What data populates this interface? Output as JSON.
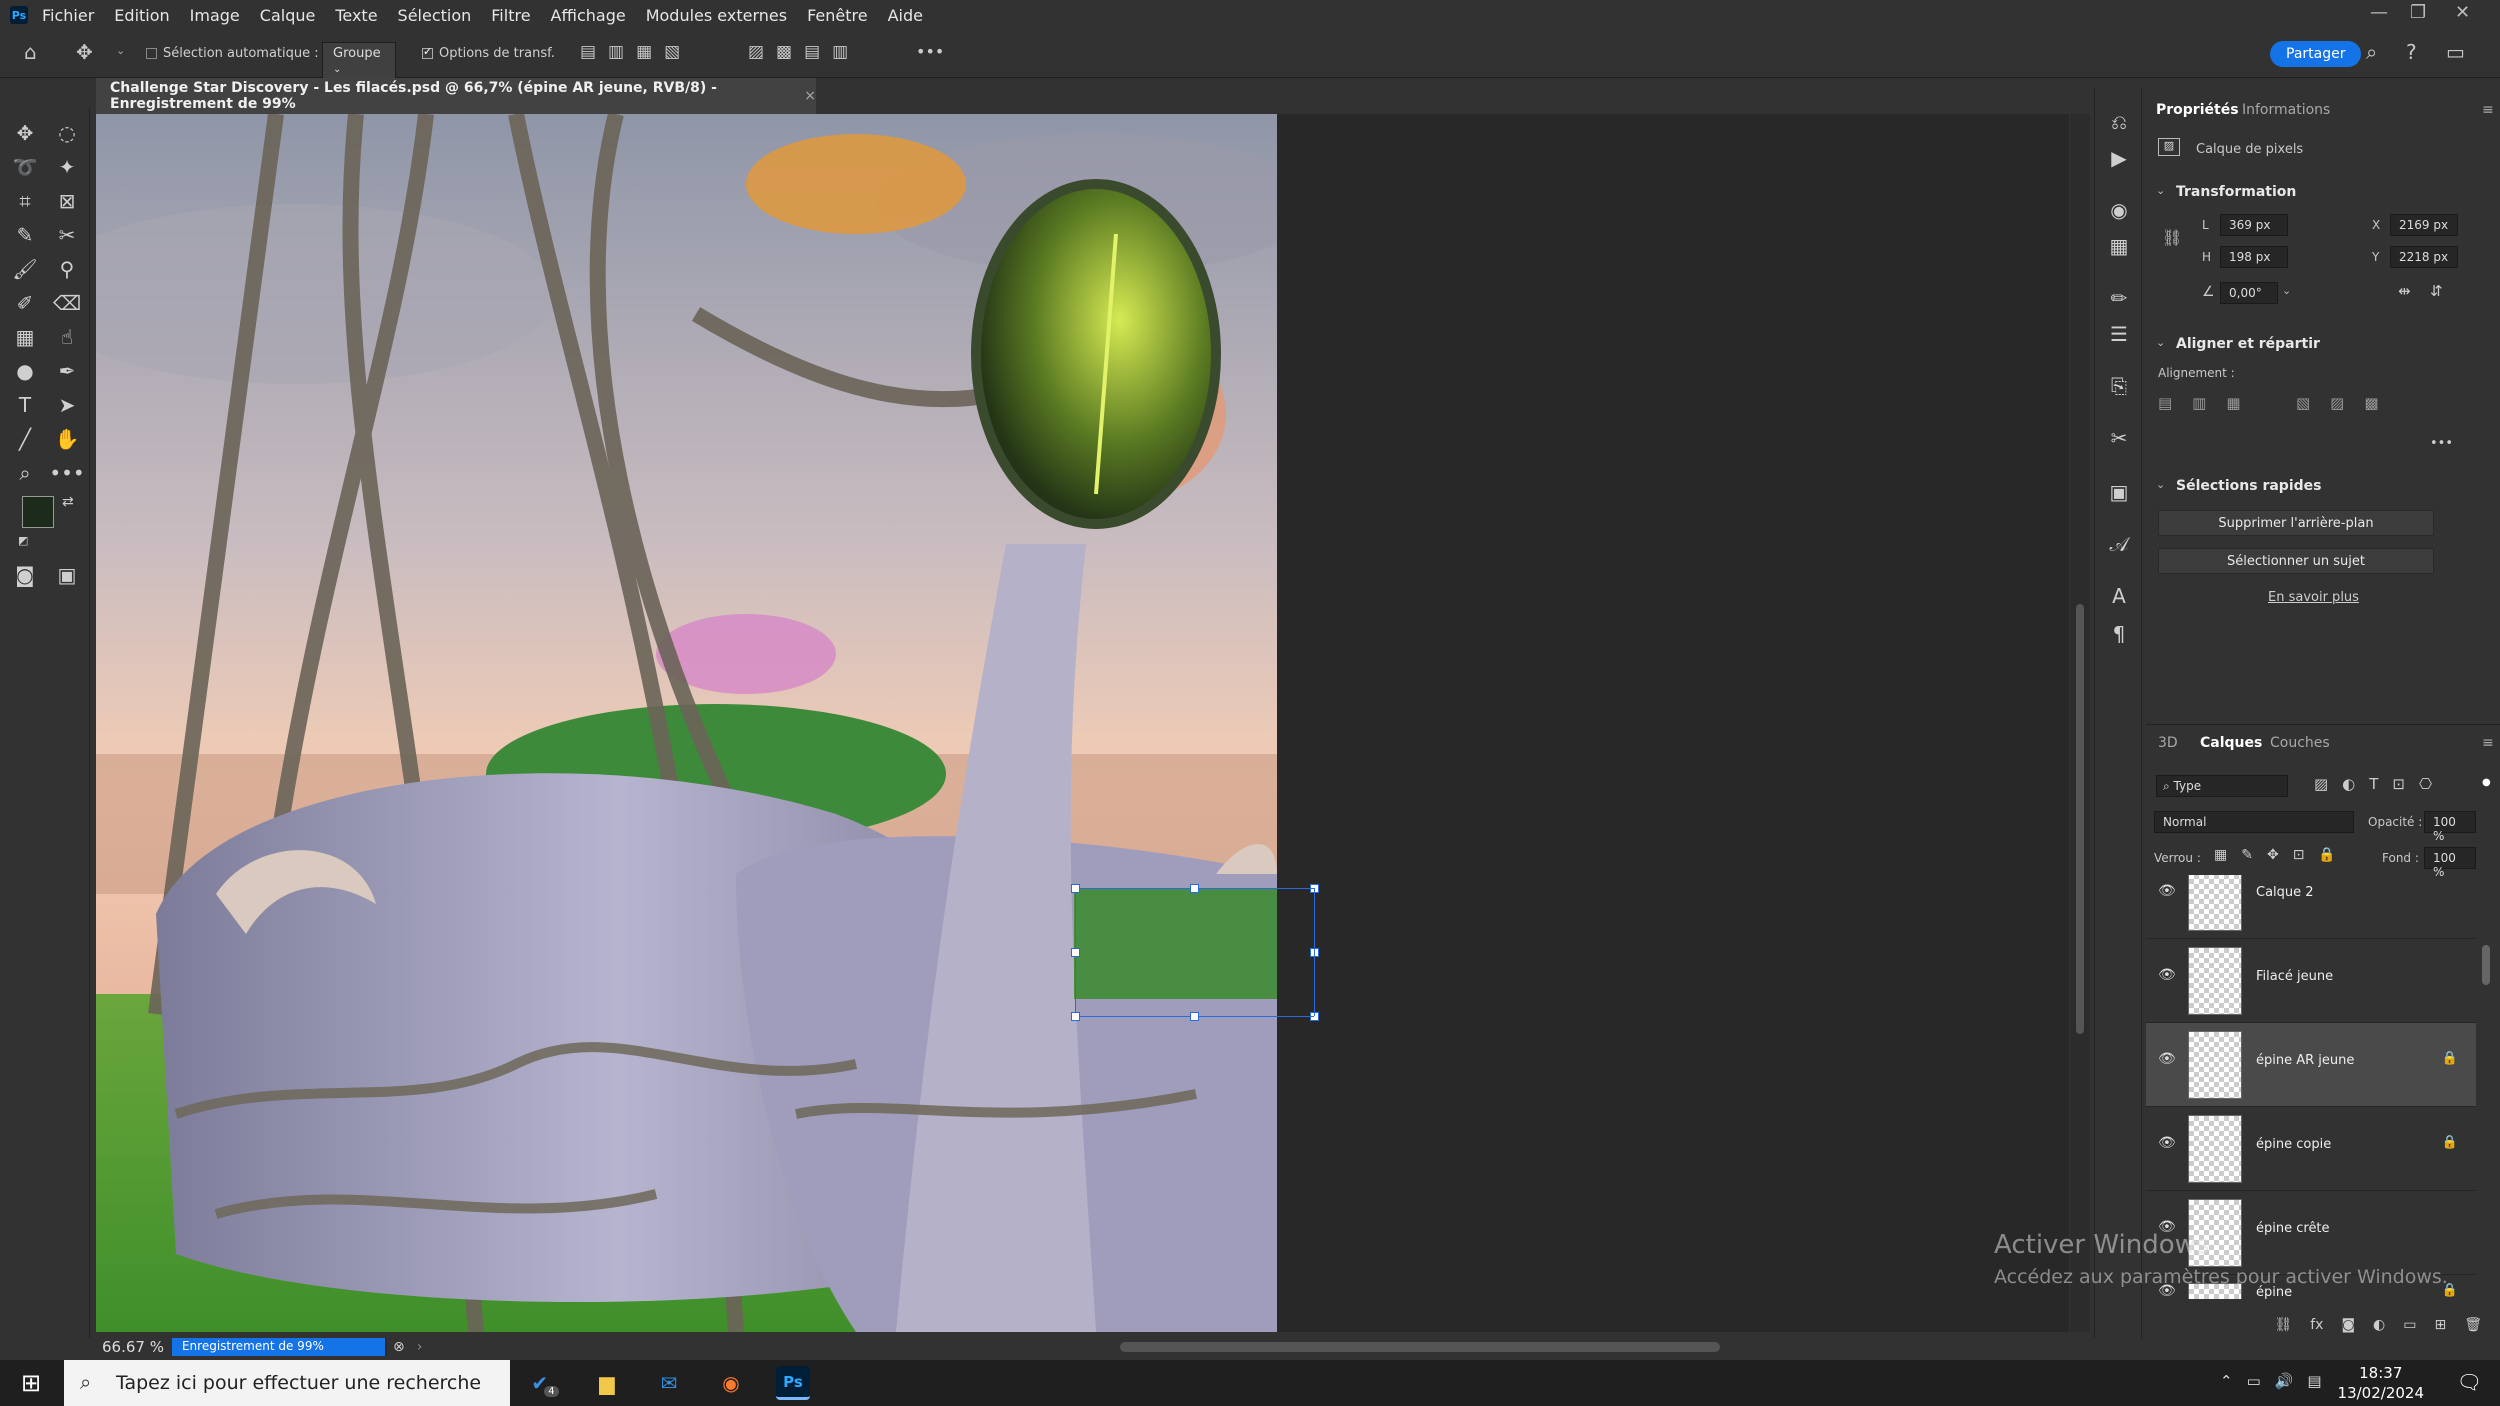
{
  "menubar": {
    "logo": "Ps",
    "items": [
      "Fichier",
      "Edition",
      "Image",
      "Calque",
      "Texte",
      "Sélection",
      "Filtre",
      "Affichage",
      "Modules externes",
      "Fenêtre",
      "Aide"
    ]
  },
  "options": {
    "auto_select_label": "Sélection automatique :",
    "group_value": "Groupe",
    "transform_options_label": "Options de transf.",
    "more": "•••",
    "share_label": "Partager"
  },
  "document": {
    "tab_title": "Challenge Star Discovery - Les filacés.psd @ 66,7% (épine AR jeune, RVB/8) - Enregistrement de 99%",
    "close_glyph": "×"
  },
  "properties": {
    "tabs": [
      "Propriétés",
      "Informations"
    ],
    "layer_type": "Calque de pixels",
    "transform_title": "Transformation",
    "w_label": "L",
    "w_value": "369 px",
    "h_label": "H",
    "h_value": "198 px",
    "x_label": "X",
    "x_value": "2169 px",
    "y_label": "Y",
    "y_value": "2218 px",
    "angle_value": "0,00°",
    "align_title": "Aligner et répartir",
    "alignment_label": "Alignement :",
    "quick_title": "Sélections rapides",
    "remove_bg": "Supprimer l'arrière-plan",
    "select_subject": "Sélectionner un sujet",
    "learn_more": "En savoir plus",
    "more": "•••"
  },
  "layers_panel": {
    "tabs": [
      "3D",
      "Calques",
      "Couches"
    ],
    "filter_value": "Type",
    "blend_mode": "Normal",
    "opacity_label": "Opacité :",
    "opacity_value": "100 %",
    "lock_label": "Verrou :",
    "fill_label": "Fond :",
    "fill_value": "100 %",
    "layers": [
      {
        "name": "Calque 2",
        "locked": false,
        "selected": false
      },
      {
        "name": "Filacé jeune",
        "locked": false,
        "selected": false
      },
      {
        "name": "épine AR jeune",
        "locked": true,
        "selected": true
      },
      {
        "name": "épine copie",
        "locked": true,
        "selected": false
      },
      {
        "name": "épine crête",
        "locked": false,
        "selected": false
      },
      {
        "name": "épine",
        "locked": true,
        "selected": false
      }
    ]
  },
  "status": {
    "zoom": "66.67 %",
    "progress_label": "Enregistrement de 99%",
    "progress": 0.99
  },
  "watermark": {
    "line1": "Activer Windows",
    "line2": "Accédez aux paramètres pour activer Windows."
  },
  "taskbar": {
    "search_placeholder": "Tapez ici pour effectuer une recherche",
    "badge": "4",
    "ps_label": "Ps",
    "time": "18:37",
    "date": "13/02/2024"
  },
  "colors": {
    "accent": "#1473e6",
    "foreground_swatch": "#1d2b1c",
    "background_swatch": "#b8f07a"
  }
}
